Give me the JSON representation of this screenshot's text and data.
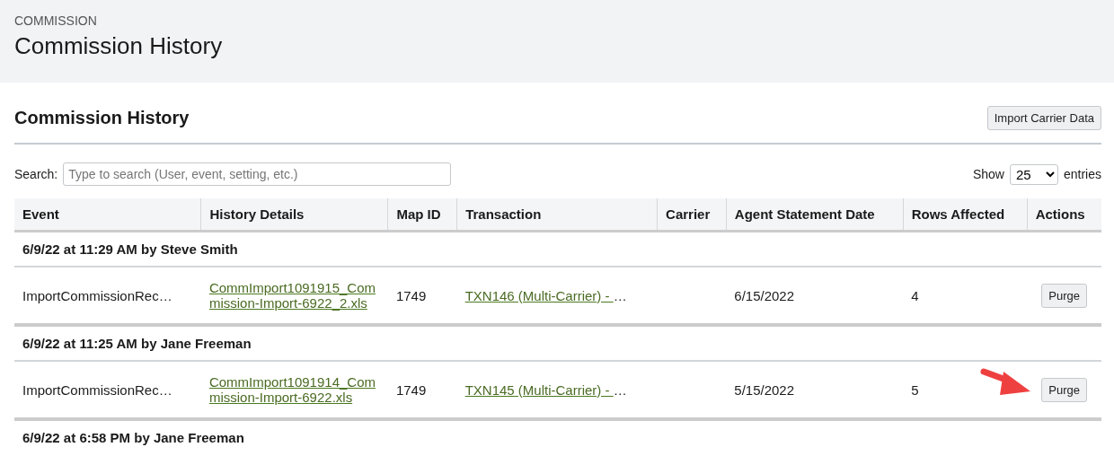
{
  "header": {
    "breadcrumb": "COMMISSION",
    "title": "Commission History"
  },
  "panel": {
    "title": "Commission History",
    "import_button": "Import Carrier Data",
    "search": {
      "label": "Search:",
      "placeholder": "Type to search (User, event, setting, etc.)"
    },
    "page_size": {
      "show_label": "Show",
      "value": "25",
      "entries_label": "entries"
    },
    "table": {
      "columns": [
        "Event",
        "History Details",
        "Map ID",
        "Transaction",
        "Carrier",
        "Agent Statement Date",
        "Rows Affected",
        "Actions"
      ],
      "groups": [
        {
          "heading": "6/9/22 at 11:29 AM by Steve Smith",
          "rows": [
            {
              "event": "ImportCommissionRec…",
              "history_details": "CommImport1091915_Commission-Import-6922_2.xls",
              "map_id": "1749",
              "transaction": "TXN146 (Multi-Carrier) - ",
              "transaction_more": "…",
              "agent_statement_date": "6/15/2022",
              "rows_affected": "4",
              "action": "Purge",
              "pointed_at": false
            }
          ]
        },
        {
          "heading": "6/9/22 at 11:25 AM by Jane Freeman",
          "rows": [
            {
              "event": "ImportCommissionRec…",
              "history_details": "CommImport1091914_Commission-Import-6922.xls",
              "map_id": "1749",
              "transaction": "TXN145 (Multi-Carrier) - ",
              "transaction_more": "…",
              "agent_statement_date": "5/15/2022",
              "rows_affected": "5",
              "action": "Purge",
              "pointed_at": true
            }
          ]
        },
        {
          "heading": "6/9/22 at 6:58 PM by Jane Freeman"
        }
      ]
    }
  }
}
